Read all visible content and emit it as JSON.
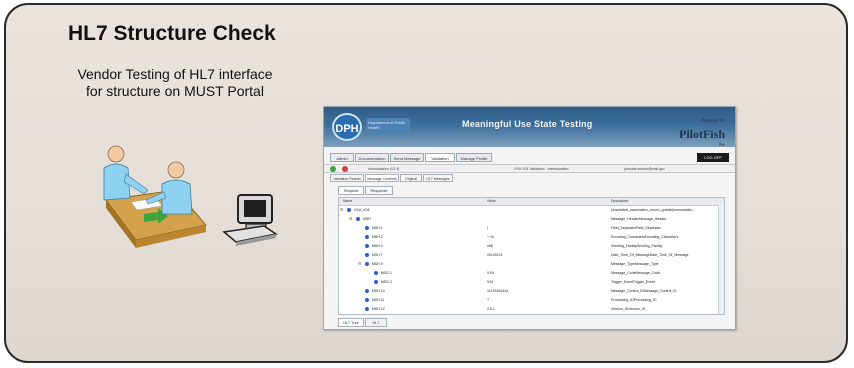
{
  "slide": {
    "title": "HL7 Structure Check",
    "subtitle_lines": [
      "Vendor Testing of HL7 interface",
      "for structure  on MUST Portal"
    ]
  },
  "screenshot": {
    "banner": {
      "logo_text": "DPH",
      "tag_text": "Department of Public Health",
      "title": "Meaningful Use State Testing",
      "partner_small": "Powered by",
      "partner": "PilotFish",
      "partner_sub": "itw"
    },
    "menu_tabs": [
      "Admin",
      "Documentation",
      "Send Message",
      "Validation",
      "Manage Profile"
    ],
    "logoff_label": "LOG OFF",
    "toolbar_texts": [
      "Immunization (V2.5)",
      "VXU V04 Validation - Immunization",
      "johndoe.vendor@mail.gov"
    ],
    "sub_tabs": [
      "Validation Results",
      "Message Contents",
      "Original",
      "HL7 Messages"
    ],
    "request_tabs": [
      "Request",
      "Response"
    ],
    "grid": {
      "columns": [
        "Name",
        "Value",
        "Description"
      ],
      "rows": [
        {
          "indent": 0,
          "expander": "⊟",
          "name": "VXU_V04",
          "value": "",
          "desc": "Unsolicited_vaccination_record_update(Immunizatio..."
        },
        {
          "indent": 1,
          "expander": "⊟",
          "name": "MSH",
          "value": "",
          "desc": "Message_HeaderMessage_Header"
        },
        {
          "indent": 2,
          "expander": "",
          "name": "MSH.1",
          "value": "|",
          "desc": "Field_SeparatorField_Separator"
        },
        {
          "indent": 2,
          "expander": "",
          "name": "MSH.2",
          "value": "^~\\&",
          "desc": "Encoding_CharactersEncoding_Characters"
        },
        {
          "indent": 2,
          "expander": "",
          "name": "MSH.4",
          "value": "v68",
          "desc": "Sending_FacilitySending_Facility"
        },
        {
          "indent": 2,
          "expander": "",
          "name": "MSH.7",
          "value": "20100101",
          "desc": "Date_Time_Of_MessageDate_Time_Of_Message"
        },
        {
          "indent": 2,
          "expander": "⊟",
          "name": "MSH.9",
          "value": "",
          "desc": "Message_TypeMessage_Type"
        },
        {
          "indent": 3,
          "expander": "",
          "name": "MSG.1",
          "value": "VXU",
          "desc": "Message_CodeMessage_Code"
        },
        {
          "indent": 3,
          "expander": "",
          "name": "MSG.2",
          "value": "V04",
          "desc": "Trigger_EventTrigger_Event"
        },
        {
          "indent": 2,
          "expander": "",
          "name": "MSH.10",
          "value": "1147619042a",
          "desc": "Message_Control_IDMessage_Control_ID"
        },
        {
          "indent": 2,
          "expander": "",
          "name": "MSH.11",
          "value": "T",
          "desc": "Processing_IDProcessing_ID"
        },
        {
          "indent": 2,
          "expander": "",
          "name": "MSH.12",
          "value": "2.5.1",
          "desc": "Version_IDVersion_ID"
        }
      ]
    },
    "bottom_tabs": [
      "HL7 Tree",
      "HL7"
    ]
  },
  "colors": {
    "card_bg": "#e8e1da",
    "banner": "#3d6e9c",
    "tree_dot": "#2b5fd0"
  },
  "icons": [
    "people-at-table-icon",
    "computer-icon",
    "dph-logo",
    "green-arrow-icon"
  ]
}
